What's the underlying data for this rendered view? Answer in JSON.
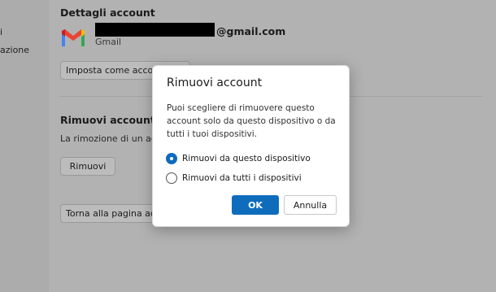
{
  "sidebar": {
    "items": [
      {
        "label": "i"
      },
      {
        "label": "azione"
      }
    ]
  },
  "account_details": {
    "title": "Dettagli account",
    "email_suffix": "@gmail.com",
    "account_type": "Gmail",
    "set_default_button": "Imposta come account p"
  },
  "remove_section": {
    "title": "Rimuovi account da O",
    "description": "La rimozione di un accou",
    "remove_button": "Rimuovi",
    "back_button": "Torna alla pagina accou"
  },
  "dialog": {
    "title": "Rimuovi account",
    "text": "Puoi scegliere di rimuovere questo account solo da questo dispositivo o da tutti i tuoi dispositivi.",
    "options": [
      {
        "label": "Rimuovi da questo dispositivo",
        "checked": true
      },
      {
        "label": "Rimuovi da tutti i dispositivi",
        "checked": false
      }
    ],
    "ok_label": "OK",
    "cancel_label": "Annulla",
    "accent_color": "#0f6cbd"
  }
}
